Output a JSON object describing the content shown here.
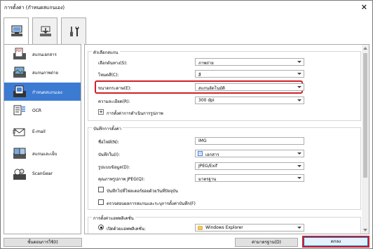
{
  "window": {
    "title": "การตั้งค่า (กำหนดสแกนเอง)",
    "close_glyph": "✕"
  },
  "tabs": [
    {
      "icon": "scan-from-computer-icon",
      "selected": true
    },
    {
      "icon": "scan-from-operation-panel-icon",
      "selected": false
    },
    {
      "icon": "general-settings-tools-icon",
      "selected": false
    }
  ],
  "sidebar": {
    "items": [
      {
        "label": "สแกนเอกสาร",
        "icon": "document-scan-icon",
        "selected": false
      },
      {
        "label": "สแกนภาพถ่าย",
        "icon": "photo-scan-icon",
        "selected": false
      },
      {
        "label": "กำหนดสแกนเอง",
        "icon": "custom-scan-icon",
        "selected": true
      },
      {
        "label": "OCR",
        "icon": "ocr-icon",
        "selected": false
      },
      {
        "label": "E-mail",
        "icon": "email-icon",
        "selected": false
      },
      {
        "label": "สแกนและเย็บ",
        "icon": "stitch-icon",
        "selected": false
      },
      {
        "label": "ScanGear",
        "icon": "scangear-icon",
        "selected": false
      }
    ]
  },
  "scan_options": {
    "title": "ตัวเลือกสแกน",
    "source_label": "เลือกต้นทาง(S):",
    "source_value": "ภาพถ่าย",
    "color_mode_label": "โหมดสี(C):",
    "color_mode_value": "สี",
    "paper_size_label": "ขนาดกระดาษ(E):",
    "paper_size_value": "สแกนอัตโนมัติ",
    "resolution_label": "ความละเอียด(R):",
    "resolution_value": "300 dpi",
    "image_processing_label": "การตั้งค่าการดำเนินการรูปภาพ",
    "expander_glyph": "+"
  },
  "save_settings": {
    "title": "บันทึกการตั้งค่า",
    "file_name_label": "ชื่อไฟล์(N):",
    "file_name_value": "IMG",
    "save_in_label": "บันทึกใน(I):",
    "save_in_value": "เอกสาร",
    "data_format_label": "รูปแบบข้อมูล(D):",
    "data_format_value": "JPEG/Exif",
    "jpeg_quality_label": "คุณภาพรูปภาพ JPEG(Q):",
    "jpeg_quality_value": "มาตรฐาน",
    "subfolder_label": "บันทึกไปที่โฟลเดอร์ย่อยด้วยวันที่ปัจจุบัน",
    "check_results_label": "ตรวจสอบผลการสแกนและระบุการตั้งค่าบันทึก(F)"
  },
  "app_settings": {
    "title": "การตั้งค่าแอพพลิเคชั่น",
    "open_with_label": "เปิดด้วยแอพพลิเคชั่น:",
    "open_with_value": "Windows Explorer"
  },
  "footer": {
    "instructions_label": "ขั้นตอนการใช้(I)",
    "defaults_label": "ค่ามาตรฐาน(D)",
    "ok_label": "ตกลง"
  },
  "colors": {
    "selected": "#3d7bd2",
    "highlight": "#d21f26"
  }
}
